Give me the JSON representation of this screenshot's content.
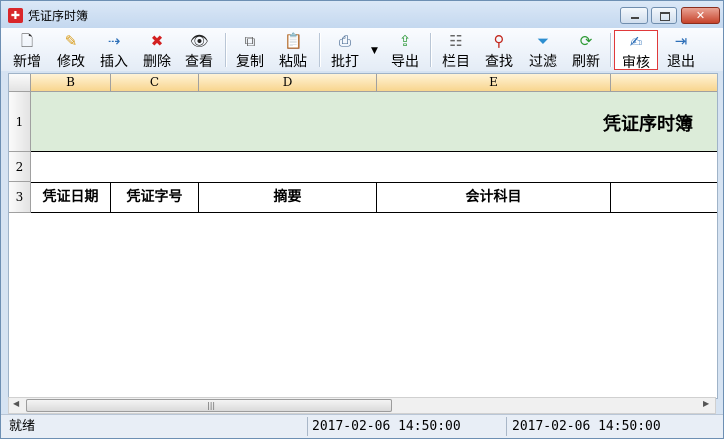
{
  "window": {
    "title": "凭证序时簿",
    "colors": {
      "accent": "#e0393a",
      "title_row_bg": "#dcecd9"
    }
  },
  "toolbar": {
    "items": [
      {
        "label": "新增",
        "icon": "add-icon"
      },
      {
        "label": "修改",
        "icon": "pencil-icon"
      },
      {
        "label": "插入",
        "icon": "insert-icon"
      },
      {
        "label": "删除",
        "icon": "delete-x-icon"
      },
      {
        "label": "查看",
        "icon": "eye-icon"
      },
      {
        "label": "复制",
        "icon": "copy-icon"
      },
      {
        "label": "粘贴",
        "icon": "paste-icon"
      },
      {
        "label": "批打",
        "icon": "printer-icon"
      },
      {
        "label": "导出",
        "icon": "export-icon"
      },
      {
        "label": "栏目",
        "icon": "columns-icon"
      },
      {
        "label": "查找",
        "icon": "find-icon"
      },
      {
        "label": "过滤",
        "icon": "filter-icon"
      },
      {
        "label": "刷新",
        "icon": "refresh-icon"
      },
      {
        "label": "审核",
        "icon": "audit-icon"
      },
      {
        "label": "退出",
        "icon": "exit-icon"
      }
    ]
  },
  "grid": {
    "column_headers": [
      "B",
      "C",
      "D",
      "E"
    ],
    "row_numbers": [
      "1",
      "2",
      "3"
    ],
    "sheet_title": "凭证序时簿",
    "header_cells": [
      "凭证日期",
      "凭证字号",
      "摘要",
      "会计科目"
    ]
  },
  "statusbar": {
    "status": "就绪",
    "time1": "2017-02-06 14:50:00",
    "time2": "2017-02-06 14:50:00"
  }
}
